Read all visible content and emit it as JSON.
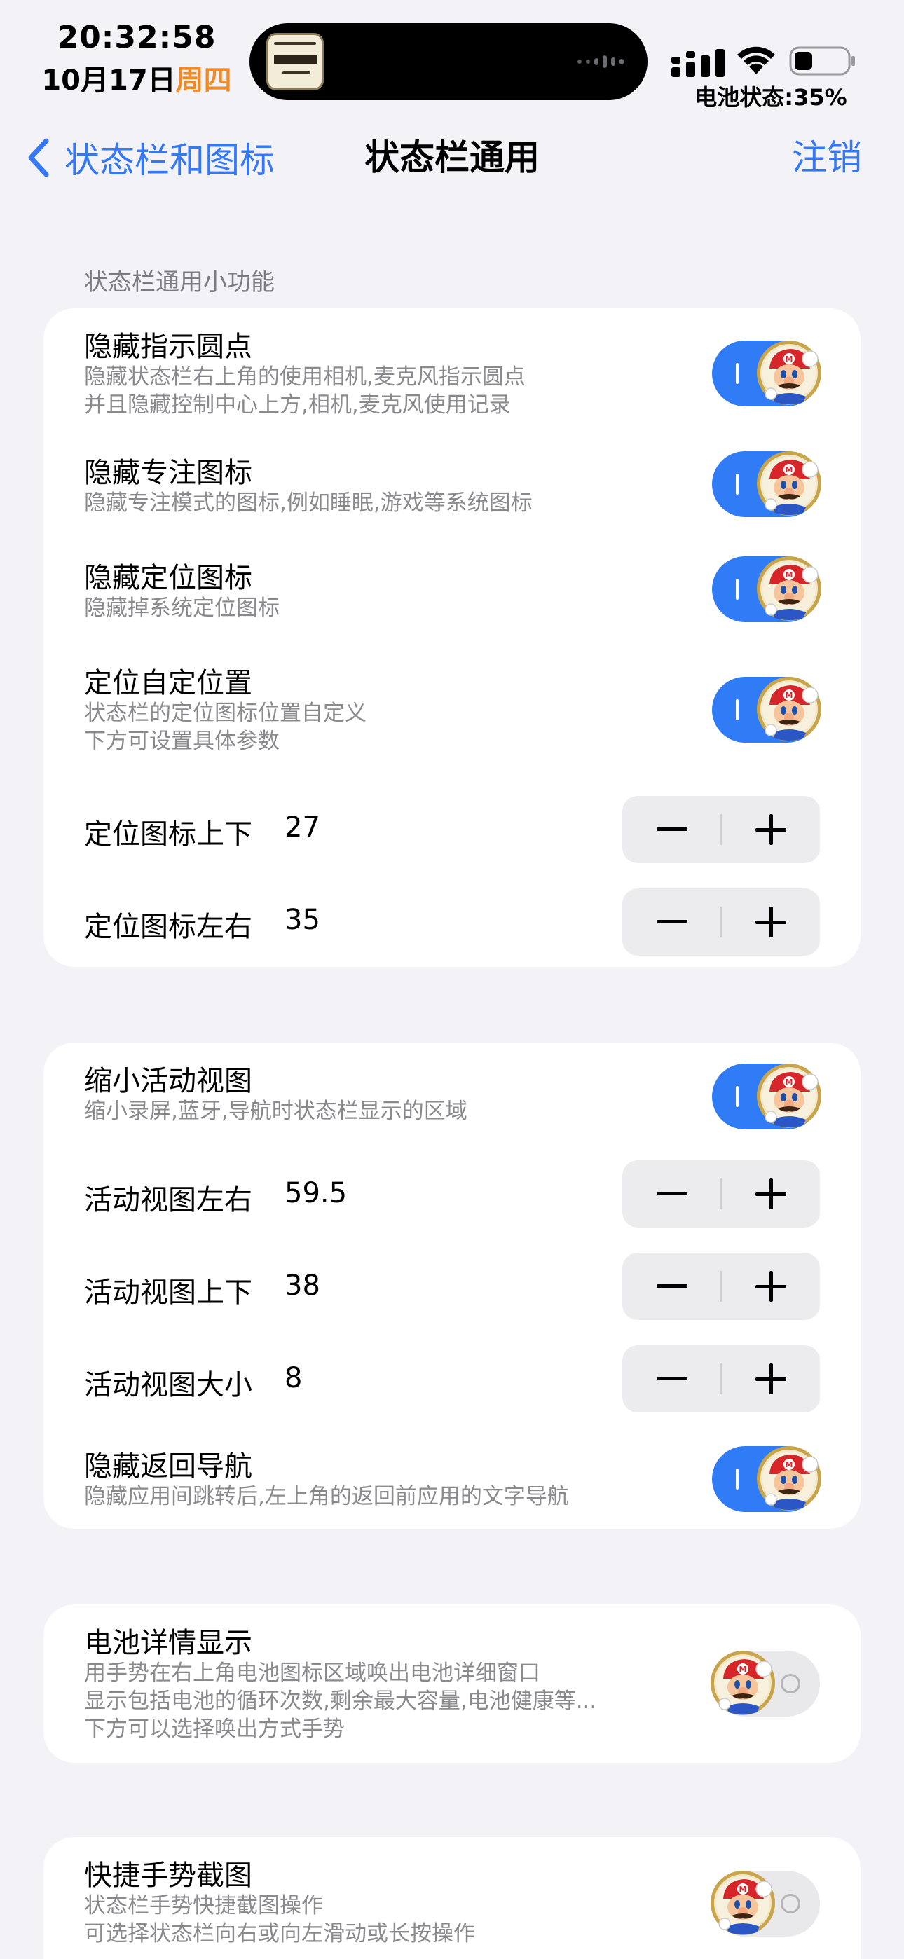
{
  "status_bar": {
    "time": "20:32:58",
    "date": "10月17日",
    "weekday": "周四",
    "battery_status": "电池状态:35%",
    "battery_level": 0.35,
    "island_art_icon": "album-cover-icon",
    "colors": {
      "weekday": "#f08a24"
    }
  },
  "nav": {
    "back_label": "状态栏和图标",
    "title": "状态栏通用",
    "action_label": "注销"
  },
  "section1": {
    "header": "状态栏通用小功能",
    "hide_dot": {
      "title": "隐藏指示圆点",
      "desc1": "隐藏状态栏右上角的使用相机,麦克风指示圆点",
      "desc2": "并且隐藏控制中心上方,相机,麦克风使用记录",
      "on": true
    },
    "hide_focus": {
      "title": "隐藏专注图标",
      "desc1": "隐藏专注模式的图标,例如睡眠,游戏等系统图标",
      "on": true
    },
    "hide_location": {
      "title": "隐藏定位图标",
      "desc1": "隐藏掉系统定位图标",
      "on": true
    },
    "custom_location": {
      "title": "定位自定位置",
      "desc1": "状态栏的定位图标位置自定义",
      "desc2": "下方可设置具体参数",
      "on": true
    },
    "loc_vertical": {
      "title": "定位图标上下",
      "value": "27"
    },
    "loc_horizontal": {
      "title": "定位图标左右",
      "value": "35"
    }
  },
  "section2": {
    "shrink_activity": {
      "title": "缩小活动视图",
      "desc1": "缩小录屏,蓝牙,导航时状态栏显示的区域",
      "on": true
    },
    "act_horizontal": {
      "title": "活动视图左右",
      "value": "59.5"
    },
    "act_vertical": {
      "title": "活动视图上下",
      "value": "38"
    },
    "act_size": {
      "title": "活动视图大小",
      "value": "8"
    },
    "hide_back_nav": {
      "title": "隐藏返回导航",
      "desc1": "隐藏应用间跳转后,左上角的返回前应用的文字导航",
      "on": true
    }
  },
  "section3": {
    "battery_detail": {
      "title": "电池详情显示",
      "desc1": "用手势在右上角电池图标区域唤出电池详细窗口",
      "desc2": "显示包括电池的循环次数,剩余最大容量,电池健康等...",
      "desc3": "下方可以选择唤出方式手势",
      "on": false
    }
  },
  "section4": {
    "quick_screenshot": {
      "title": "快捷手势截图",
      "desc1": "状态栏手势快捷截图操作",
      "desc2": "可选择状态栏向右或向左滑动或长按操作",
      "on": false
    }
  },
  "icons": {
    "toggle_knob": "mario-avatar-icon",
    "stepper_minus": "minus-icon",
    "stepper_plus": "plus-icon",
    "back": "chevron-left-icon"
  },
  "colors": {
    "accent": "#3478f6",
    "toggle_on": "#2f7cf6",
    "toggle_off": "#e9e9eb",
    "background": "#f2f2f7",
    "card": "#ffffff"
  }
}
